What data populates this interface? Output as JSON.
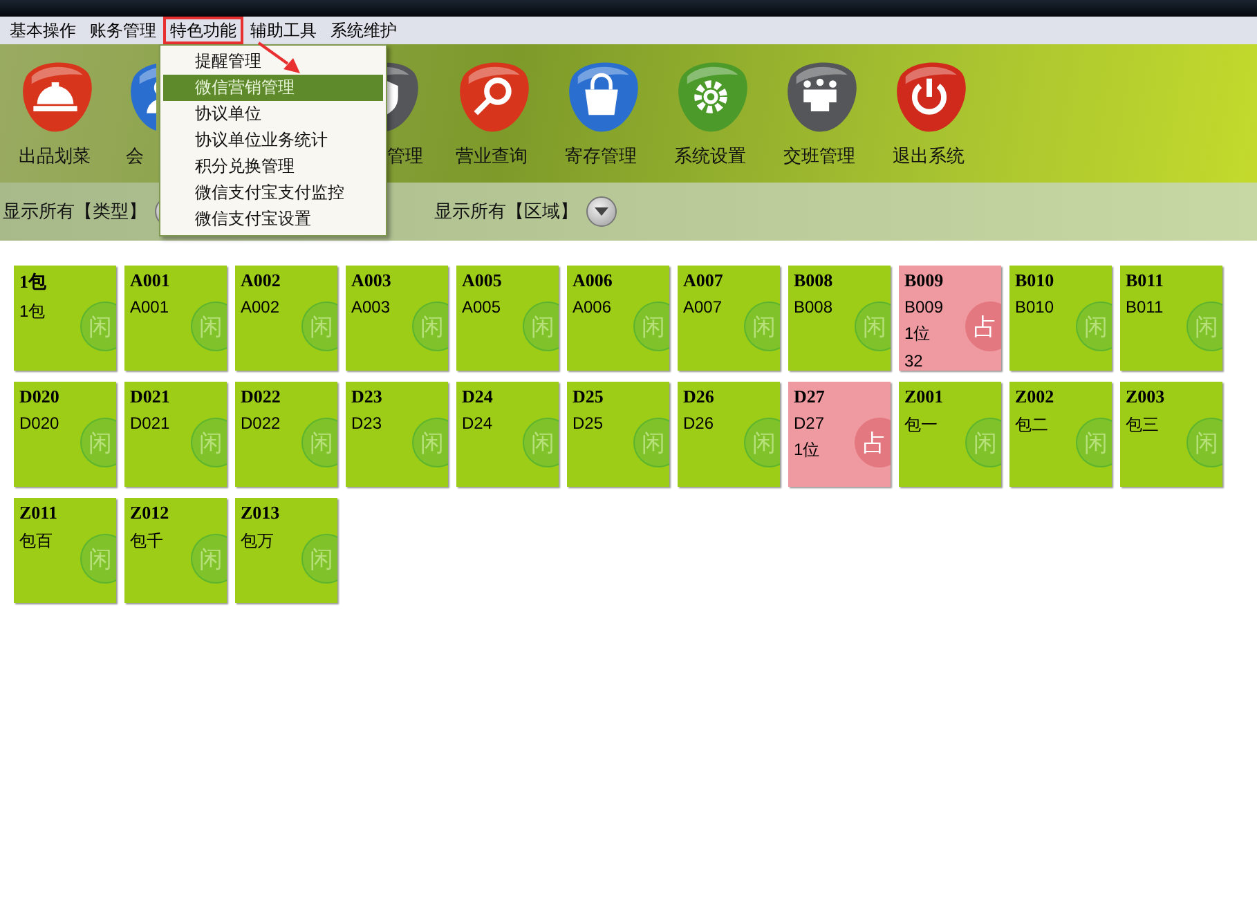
{
  "menu_bar": [
    {
      "label": "基本操作",
      "selected": false
    },
    {
      "label": "账务管理",
      "selected": false
    },
    {
      "label": "特色功能",
      "selected": true
    },
    {
      "label": "辅助工具",
      "selected": false
    },
    {
      "label": "系统维护",
      "selected": false
    }
  ],
  "dropdown_menu": [
    {
      "label": "提醒管理",
      "selected": false
    },
    {
      "label": "微信营销管理",
      "selected": true
    },
    {
      "label": "协议单位",
      "selected": false
    },
    {
      "label": "协议单位业务统计",
      "selected": false
    },
    {
      "label": "积分兑换管理",
      "selected": false
    },
    {
      "label": "微信支付宝支付监控",
      "selected": false
    },
    {
      "label": "微信支付宝设置",
      "selected": false
    }
  ],
  "toolbar": [
    {
      "kind": "bell",
      "label": "出品划菜"
    },
    {
      "kind": "person",
      "label": "会"
    },
    {
      "kind": "hidden"
    },
    {
      "kind": "shield",
      "label": "管理"
    },
    {
      "kind": "search",
      "label": "营业查询"
    },
    {
      "kind": "bag",
      "label": "寄存管理"
    },
    {
      "kind": "gear",
      "label": "系统设置"
    },
    {
      "kind": "people",
      "label": "交班管理"
    },
    {
      "kind": "power",
      "label": "退出系统"
    }
  ],
  "filters": [
    {
      "label": "显示所有【类型】"
    },
    {
      "label": "显示所有【区域】"
    }
  ],
  "tiles": [
    {
      "code": "1包",
      "name": "1包",
      "occupied": false,
      "badge": "闲"
    },
    {
      "code": "A001",
      "name": "A001",
      "occupied": false,
      "badge": "闲"
    },
    {
      "code": "A002",
      "name": "A002",
      "occupied": false,
      "badge": "闲"
    },
    {
      "code": "A003",
      "name": "A003",
      "occupied": false,
      "badge": "闲"
    },
    {
      "code": "A005",
      "name": "A005",
      "occupied": false,
      "badge": "闲"
    },
    {
      "code": "A006",
      "name": "A006",
      "occupied": false,
      "badge": "闲"
    },
    {
      "code": "A007",
      "name": "A007",
      "occupied": false,
      "badge": "闲"
    },
    {
      "code": "B008",
      "name": "B008",
      "occupied": false,
      "badge": "闲"
    },
    {
      "code": "B009",
      "name": "B009",
      "guests": "1位",
      "amount": "32",
      "occupied": true,
      "badge": "占"
    },
    {
      "code": "B010",
      "name": "B010",
      "occupied": false,
      "badge": "闲"
    },
    {
      "code": "B011",
      "name": "B011",
      "occupied": false,
      "badge": "闲"
    },
    {
      "code": "D020",
      "name": "D020",
      "occupied": false,
      "badge": "闲"
    },
    {
      "code": "D021",
      "name": "D021",
      "occupied": false,
      "badge": "闲"
    },
    {
      "code": "D022",
      "name": "D022",
      "occupied": false,
      "badge": "闲"
    },
    {
      "code": "D23",
      "name": "D23",
      "occupied": false,
      "badge": "闲"
    },
    {
      "code": "D24",
      "name": "D24",
      "occupied": false,
      "badge": "闲"
    },
    {
      "code": "D25",
      "name": "D25",
      "occupied": false,
      "badge": "闲"
    },
    {
      "code": "D26",
      "name": "D26",
      "occupied": false,
      "badge": "闲"
    },
    {
      "code": "D27",
      "name": "D27",
      "guests": "1位",
      "occupied": true,
      "badge": "占"
    },
    {
      "code": "Z001",
      "name": "包一",
      "occupied": false,
      "badge": "闲"
    },
    {
      "code": "Z002",
      "name": "包二",
      "occupied": false,
      "badge": "闲"
    },
    {
      "code": "Z003",
      "name": "包三",
      "occupied": false,
      "badge": "闲"
    },
    {
      "code": "Z011",
      "name": "包百",
      "occupied": false,
      "badge": "闲"
    },
    {
      "code": "Z012",
      "name": "包千",
      "occupied": false,
      "badge": "闲"
    },
    {
      "code": "Z013",
      "name": "包万",
      "occupied": false,
      "badge": "闲"
    }
  ]
}
